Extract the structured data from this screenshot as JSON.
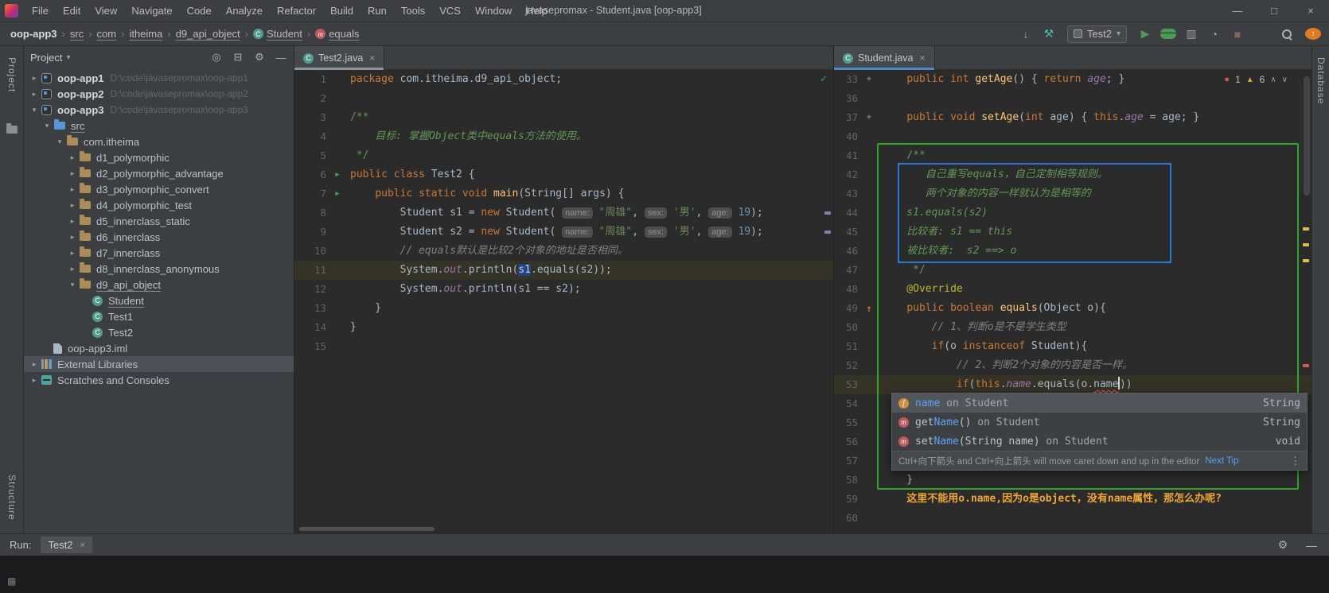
{
  "window": {
    "title": "javasepromax - Student.java [oop-app3]",
    "menus": [
      "File",
      "Edit",
      "View",
      "Navigate",
      "Code",
      "Analyze",
      "Refactor",
      "Build",
      "Run",
      "Tools",
      "VCS",
      "Window",
      "Help"
    ],
    "controls": {
      "minimize": "—",
      "maximize": "□",
      "close": "×"
    }
  },
  "navbar": {
    "separator": "›",
    "breadcrumbs": [
      {
        "label": "oop-app3",
        "bold": true
      },
      {
        "label": "src",
        "underline": true
      },
      {
        "label": "com",
        "underline": true
      },
      {
        "label": "itheima",
        "underline": true
      },
      {
        "label": "d9_api_object",
        "underline": true
      },
      {
        "label": "Student",
        "icon": "cls",
        "underline": true
      },
      {
        "label": "equals",
        "icon": "method",
        "underline": true
      }
    ],
    "run_config": "Test2",
    "run_config_caret": "▾",
    "tools_left": [
      {
        "name": "vcs-update-icon",
        "glyph": "↓",
        "color": "#9da0a3"
      },
      {
        "name": "build-hammer-icon",
        "glyph": "⚒",
        "color": "#4eb8ac"
      }
    ],
    "tools_right": [
      {
        "name": "run-button",
        "glyph": "▶",
        "color": "#499c54"
      },
      {
        "name": "debug-button",
        "css": "bug"
      },
      {
        "name": "coverage-icon",
        "glyph": "▥",
        "color": "#9da0a3"
      },
      {
        "name": "profiler-icon",
        "glyph": "◔",
        "color": "#9da0a3"
      },
      {
        "name": "stop-button",
        "glyph": "■",
        "color": "#87635f"
      }
    ],
    "tools_far": [
      {
        "name": "search-everywhere-icon",
        "css": "search"
      },
      {
        "name": "ide-update-icon",
        "css": "appupd",
        "glyph": "↑"
      }
    ]
  },
  "project_panel": {
    "title": "Project",
    "caret": "▾",
    "chev_open": "▾",
    "chev_closed": "▸",
    "icons": [
      {
        "name": "select-opened-file-icon",
        "glyph": "◎"
      },
      {
        "name": "collapse-all-icon",
        "glyph": "⊟"
      },
      {
        "name": "settings-icon",
        "glyph": "⚙"
      },
      {
        "name": "hide-panel-icon",
        "glyph": "—"
      }
    ],
    "tree": [
      {
        "d": 0,
        "c": "closed",
        "i": "prj",
        "l": "oop-app1",
        "p": "D:\\code\\javasepromax\\oop-app1",
        "b": true
      },
      {
        "d": 0,
        "c": "closed",
        "i": "prj",
        "l": "oop-app2",
        "p": "D:\\code\\javasepromax\\oop-app2",
        "b": true
      },
      {
        "d": 0,
        "c": "open",
        "i": "prj",
        "l": "oop-app3",
        "p": "D:\\code\\javasepromax\\oop-app3",
        "b": true
      },
      {
        "d": 1,
        "c": "open",
        "i": "fsrc",
        "l": "src",
        "u": true
      },
      {
        "d": 2,
        "c": "open",
        "i": "fold",
        "l": "com.itheima"
      },
      {
        "d": 3,
        "c": "closed",
        "i": "fold",
        "l": "d1_polymorphic"
      },
      {
        "d": 3,
        "c": "closed",
        "i": "fold",
        "l": "d2_polymorphic_advantage"
      },
      {
        "d": 3,
        "c": "closed",
        "i": "fold",
        "l": "d3_polymorphic_convert"
      },
      {
        "d": 3,
        "c": "closed",
        "i": "fold",
        "l": "d4_polymorphic_test"
      },
      {
        "d": 3,
        "c": "closed",
        "i": "fold",
        "l": "d5_innerclass_static"
      },
      {
        "d": 3,
        "c": "closed",
        "i": "fold",
        "l": "d6_innerclass"
      },
      {
        "d": 3,
        "c": "closed",
        "i": "fold",
        "l": "d7_innerclass"
      },
      {
        "d": 3,
        "c": "closed",
        "i": "fold",
        "l": "d8_innerclass_anonymous"
      },
      {
        "d": 3,
        "c": "open",
        "i": "fold",
        "l": "d9_api_object",
        "u": true
      },
      {
        "d": 4,
        "c": null,
        "i": "cls",
        "l": "Student",
        "u": true
      },
      {
        "d": 4,
        "c": null,
        "i": "cls",
        "l": "Test1"
      },
      {
        "d": 4,
        "c": null,
        "i": "cls",
        "l": "Test2"
      },
      {
        "d": 1,
        "c": null,
        "i": "file",
        "l": "oop-app3.iml"
      },
      {
        "d": 0,
        "c": "closed",
        "i": "lib",
        "l": "External Libraries",
        "s": true
      },
      {
        "d": 0,
        "c": "closed",
        "i": "scr",
        "l": "Scratches and Consoles"
      }
    ]
  },
  "icons": {
    "gutter": {
      "run": "▶",
      "override": "↑",
      "fold": "+"
    }
  },
  "editor_left": {
    "tab": "Test2.java",
    "tab_close": "×",
    "inspection_ok": "✓",
    "stripe": [
      {
        "c": "#9876aa",
        "t": 178
      },
      {
        "c": "#9876aa",
        "t": 202
      }
    ],
    "lines": [
      {
        "n": 1,
        "s": [
          [
            "kw",
            "package "
          ],
          [
            "pl",
            "com.itheima.d9_api_object;"
          ]
        ]
      },
      {
        "n": 2,
        "s": []
      },
      {
        "n": 3,
        "s": [
          [
            "doc",
            "/**"
          ]
        ]
      },
      {
        "n": 4,
        "s": [
          [
            "doci",
            "    目标: 掌握Object类中equals方法的使用。"
          ]
        ]
      },
      {
        "n": 5,
        "s": [
          [
            "doc",
            " */"
          ]
        ]
      },
      {
        "n": 6,
        "g": "run",
        "s": [
          [
            "kw",
            "public class "
          ],
          [
            "pl",
            "Test2 {"
          ]
        ]
      },
      {
        "n": 7,
        "g": "run",
        "s": [
          [
            "pl",
            "    "
          ],
          [
            "kw",
            "public static void "
          ],
          [
            "mth",
            "main"
          ],
          [
            "pl",
            "(String[] args) {"
          ]
        ]
      },
      {
        "n": 8,
        "s": [
          [
            "pl",
            "        Student s1 = "
          ],
          [
            "kw",
            "new "
          ],
          [
            "pl",
            "Student( "
          ],
          [
            "hint",
            "name:"
          ],
          [
            "pl",
            " "
          ],
          [
            "str",
            "\"周雄\""
          ],
          [
            "pl",
            ", "
          ],
          [
            "hint",
            "sex:"
          ],
          [
            "pl",
            " "
          ],
          [
            "str",
            "'男'"
          ],
          [
            "pl",
            ", "
          ],
          [
            "hint",
            "age:"
          ],
          [
            "pl",
            " "
          ],
          [
            "num",
            "19"
          ],
          [
            "pl",
            ");"
          ]
        ]
      },
      {
        "n": 9,
        "s": [
          [
            "pl",
            "        Student s2 = "
          ],
          [
            "kw",
            "new "
          ],
          [
            "pl",
            "Student( "
          ],
          [
            "hint",
            "name:"
          ],
          [
            "pl",
            " "
          ],
          [
            "str",
            "\"周雄\""
          ],
          [
            "pl",
            ", "
          ],
          [
            "hint",
            "sex:"
          ],
          [
            "pl",
            " "
          ],
          [
            "str",
            "'男'"
          ],
          [
            "pl",
            ", "
          ],
          [
            "hint",
            "age:"
          ],
          [
            "pl",
            " "
          ],
          [
            "num",
            "19"
          ],
          [
            "pl",
            ");"
          ]
        ]
      },
      {
        "n": 10,
        "s": [
          [
            "pl",
            "        "
          ],
          [
            "cmt",
            "// equals默认是比较2个对象的地址是否相同。"
          ]
        ]
      },
      {
        "n": 11,
        "hl": true,
        "s": [
          [
            "pl",
            "        System."
          ],
          [
            "fld",
            "out"
          ],
          [
            "pl",
            ".println("
          ],
          [
            "sel",
            "s1"
          ],
          [
            "pl",
            ".equals(s2));"
          ]
        ]
      },
      {
        "n": 12,
        "s": [
          [
            "pl",
            "        System."
          ],
          [
            "fld",
            "out"
          ],
          [
            "pl",
            ".println(s1 == s2);"
          ]
        ]
      },
      {
        "n": 13,
        "s": [
          [
            "pl",
            "    }"
          ]
        ]
      },
      {
        "n": 14,
        "s": [
          [
            "pl",
            "}"
          ]
        ]
      },
      {
        "n": 15,
        "s": []
      }
    ]
  },
  "editor_right": {
    "tab": "Student.java",
    "tab_close": "×",
    "inspection": {
      "errors": "1",
      "warnings": "6",
      "up": "∧",
      "down": "∨"
    },
    "stripe": [
      {
        "c": "#d9bf4e",
        "t": 198
      },
      {
        "c": "#d9bf4e",
        "t": 218
      },
      {
        "c": "#d9bf4e",
        "t": 238
      },
      {
        "c": "#cf5b56",
        "t": 370
      }
    ],
    "lines": [
      {
        "n": 33,
        "g": "fold",
        "s": [
          [
            "pl",
            "    "
          ],
          [
            "kw",
            "public int "
          ],
          [
            "mth",
            "getAge"
          ],
          [
            "pl",
            "() { "
          ],
          [
            "kw",
            "return "
          ],
          [
            "fld",
            "age"
          ],
          [
            "pl",
            "; }"
          ]
        ]
      },
      {
        "n": 36,
        "s": []
      },
      {
        "n": 37,
        "g": "fold",
        "s": [
          [
            "pl",
            "    "
          ],
          [
            "kw",
            "public void "
          ],
          [
            "mth",
            "setAge"
          ],
          [
            "pl",
            "("
          ],
          [
            "kw",
            "int "
          ],
          [
            "pl",
            "age) { "
          ],
          [
            "kw",
            "this"
          ],
          [
            "pl",
            "."
          ],
          [
            "fld",
            "age"
          ],
          [
            "pl",
            " = age; }"
          ]
        ]
      },
      {
        "n": 40,
        "s": []
      },
      {
        "n": 41,
        "s": [
          [
            "doc",
            "    /**"
          ]
        ]
      },
      {
        "n": 42,
        "s": [
          [
            "doci",
            "       自己重写equals，自己定制相等规则。"
          ]
        ]
      },
      {
        "n": 43,
        "s": [
          [
            "doci",
            "       两个对象的内容一样就认为是相等的"
          ]
        ]
      },
      {
        "n": 44,
        "s": [
          [
            "doci",
            "    s1.equals(s2)"
          ]
        ]
      },
      {
        "n": 45,
        "s": [
          [
            "doci",
            "    比较者: s1 == this"
          ]
        ]
      },
      {
        "n": 46,
        "s": [
          [
            "doci",
            "    被比较者:  s2 ==> o"
          ]
        ]
      },
      {
        "n": 47,
        "s": [
          [
            "doc",
            "     */"
          ]
        ]
      },
      {
        "n": 48,
        "s": [
          [
            "ann",
            "    @Override"
          ]
        ]
      },
      {
        "n": 49,
        "g": "override",
        "s": [
          [
            "pl",
            "    "
          ],
          [
            "kw",
            "public boolean "
          ],
          [
            "mth",
            "equals"
          ],
          [
            "pl",
            "(Object o){"
          ]
        ]
      },
      {
        "n": 50,
        "s": [
          [
            "pl",
            "        "
          ],
          [
            "cmt",
            "// 1、判断o是不是学生类型"
          ]
        ]
      },
      {
        "n": 51,
        "s": [
          [
            "pl",
            "        "
          ],
          [
            "kw",
            "if"
          ],
          [
            "pl",
            "(o "
          ],
          [
            "kw",
            "instanceof "
          ],
          [
            "pl",
            "Student){"
          ]
        ]
      },
      {
        "n": 52,
        "s": [
          [
            "pl",
            "            "
          ],
          [
            "cmt",
            "// 2、判断2个对象的内容是否一样。"
          ]
        ]
      },
      {
        "n": 53,
        "hl": true,
        "s": [
          [
            "pl",
            "            "
          ],
          [
            "kw",
            "if"
          ],
          [
            "pl",
            "("
          ],
          [
            "kw",
            "this"
          ],
          [
            "pl",
            "."
          ],
          [
            "fld",
            "name"
          ],
          [
            "pl",
            ".equals(o."
          ],
          [
            "err",
            "name"
          ],
          [
            "caret",
            ""
          ],
          [
            "pl",
            "))"
          ]
        ]
      },
      {
        "n": 54,
        "s": []
      },
      {
        "n": 55,
        "s": []
      },
      {
        "n": 56,
        "s": []
      },
      {
        "n": 57,
        "s": []
      },
      {
        "n": 58,
        "s": [
          [
            "pl",
            "    }"
          ]
        ]
      },
      {
        "n": 59,
        "s": [
          [
            "note",
            "    这里不能用o.name,因为o是object，没有name属性，那怎么办呢?"
          ]
        ]
      },
      {
        "n": 60,
        "s": []
      }
    ],
    "popup": {
      "rows": [
        {
          "icon": "field",
          "selected": true,
          "parts": [
            [
              "match",
              "name"
            ],
            [
              "dim",
              " on Student"
            ]
          ],
          "type": "String"
        },
        {
          "icon": "method",
          "parts": [
            [
              "pl",
              "get"
            ],
            [
              "match",
              "Name"
            ],
            [
              "pl",
              "()"
            ],
            [
              "dim",
              " on Student"
            ]
          ],
          "type": "String"
        },
        {
          "icon": "method",
          "parts": [
            [
              "pl",
              "set"
            ],
            [
              "match",
              "Name"
            ],
            [
              "pl",
              "(String name)"
            ],
            [
              "dim",
              " on Student"
            ]
          ],
          "type": "void"
        }
      ],
      "footer": "Ctrl+向下箭头 and Ctrl+向上箭头 will move caret down and up in the editor",
      "footer_link": "Next Tip",
      "more": "⋮"
    }
  },
  "runbar": {
    "label": "Run:",
    "tab": "Test2",
    "tab_close": "×",
    "icons": [
      {
        "name": "settings-icon",
        "glyph": "⚙"
      },
      {
        "name": "hide-icon",
        "glyph": "—"
      }
    ]
  },
  "strips": {
    "project": "Project",
    "structure": "Structure",
    "database": "Database"
  },
  "statusbar": {
    "corner_icon": "▦"
  },
  "colors": {
    "accent_blue": "#4a88c7",
    "run_green": "#499c54",
    "error_red": "#e05555",
    "warning_yellow": "#d9a343",
    "annotation_orange": "#f0a732",
    "focus_box_green": "#33a42c",
    "comment_box_blue": "#2b78d4",
    "selection_blue": "#214283"
  }
}
